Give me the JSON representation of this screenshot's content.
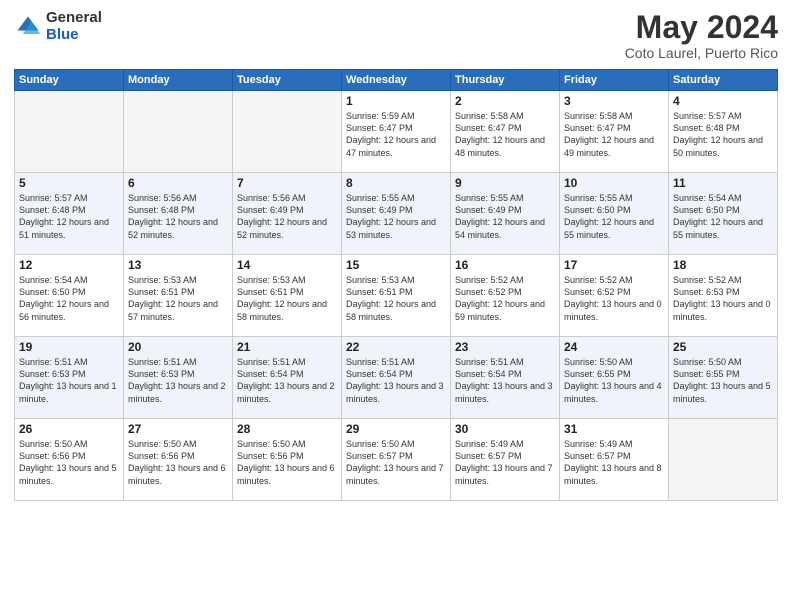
{
  "header": {
    "logo_general": "General",
    "logo_blue": "Blue",
    "title": "May 2024",
    "subtitle": "Coto Laurel, Puerto Rico"
  },
  "days_of_week": [
    "Sunday",
    "Monday",
    "Tuesday",
    "Wednesday",
    "Thursday",
    "Friday",
    "Saturday"
  ],
  "weeks": [
    [
      {
        "day": "",
        "empty": true
      },
      {
        "day": "",
        "empty": true
      },
      {
        "day": "",
        "empty": true
      },
      {
        "day": "1",
        "info": "Sunrise: 5:59 AM\nSunset: 6:47 PM\nDaylight: 12 hours\nand 47 minutes."
      },
      {
        "day": "2",
        "info": "Sunrise: 5:58 AM\nSunset: 6:47 PM\nDaylight: 12 hours\nand 48 minutes."
      },
      {
        "day": "3",
        "info": "Sunrise: 5:58 AM\nSunset: 6:47 PM\nDaylight: 12 hours\nand 49 minutes."
      },
      {
        "day": "4",
        "info": "Sunrise: 5:57 AM\nSunset: 6:48 PM\nDaylight: 12 hours\nand 50 minutes."
      }
    ],
    [
      {
        "day": "5",
        "info": "Sunrise: 5:57 AM\nSunset: 6:48 PM\nDaylight: 12 hours\nand 51 minutes."
      },
      {
        "day": "6",
        "info": "Sunrise: 5:56 AM\nSunset: 6:48 PM\nDaylight: 12 hours\nand 52 minutes."
      },
      {
        "day": "7",
        "info": "Sunrise: 5:56 AM\nSunset: 6:49 PM\nDaylight: 12 hours\nand 52 minutes."
      },
      {
        "day": "8",
        "info": "Sunrise: 5:55 AM\nSunset: 6:49 PM\nDaylight: 12 hours\nand 53 minutes."
      },
      {
        "day": "9",
        "info": "Sunrise: 5:55 AM\nSunset: 6:49 PM\nDaylight: 12 hours\nand 54 minutes."
      },
      {
        "day": "10",
        "info": "Sunrise: 5:55 AM\nSunset: 6:50 PM\nDaylight: 12 hours\nand 55 minutes."
      },
      {
        "day": "11",
        "info": "Sunrise: 5:54 AM\nSunset: 6:50 PM\nDaylight: 12 hours\nand 55 minutes."
      }
    ],
    [
      {
        "day": "12",
        "info": "Sunrise: 5:54 AM\nSunset: 6:50 PM\nDaylight: 12 hours\nand 56 minutes."
      },
      {
        "day": "13",
        "info": "Sunrise: 5:53 AM\nSunset: 6:51 PM\nDaylight: 12 hours\nand 57 minutes."
      },
      {
        "day": "14",
        "info": "Sunrise: 5:53 AM\nSunset: 6:51 PM\nDaylight: 12 hours\nand 58 minutes."
      },
      {
        "day": "15",
        "info": "Sunrise: 5:53 AM\nSunset: 6:51 PM\nDaylight: 12 hours\nand 58 minutes."
      },
      {
        "day": "16",
        "info": "Sunrise: 5:52 AM\nSunset: 6:52 PM\nDaylight: 12 hours\nand 59 minutes."
      },
      {
        "day": "17",
        "info": "Sunrise: 5:52 AM\nSunset: 6:52 PM\nDaylight: 13 hours\nand 0 minutes."
      },
      {
        "day": "18",
        "info": "Sunrise: 5:52 AM\nSunset: 6:53 PM\nDaylight: 13 hours\nand 0 minutes."
      }
    ],
    [
      {
        "day": "19",
        "info": "Sunrise: 5:51 AM\nSunset: 6:53 PM\nDaylight: 13 hours\nand 1 minute."
      },
      {
        "day": "20",
        "info": "Sunrise: 5:51 AM\nSunset: 6:53 PM\nDaylight: 13 hours\nand 2 minutes."
      },
      {
        "day": "21",
        "info": "Sunrise: 5:51 AM\nSunset: 6:54 PM\nDaylight: 13 hours\nand 2 minutes."
      },
      {
        "day": "22",
        "info": "Sunrise: 5:51 AM\nSunset: 6:54 PM\nDaylight: 13 hours\nand 3 minutes."
      },
      {
        "day": "23",
        "info": "Sunrise: 5:51 AM\nSunset: 6:54 PM\nDaylight: 13 hours\nand 3 minutes."
      },
      {
        "day": "24",
        "info": "Sunrise: 5:50 AM\nSunset: 6:55 PM\nDaylight: 13 hours\nand 4 minutes."
      },
      {
        "day": "25",
        "info": "Sunrise: 5:50 AM\nSunset: 6:55 PM\nDaylight: 13 hours\nand 5 minutes."
      }
    ],
    [
      {
        "day": "26",
        "info": "Sunrise: 5:50 AM\nSunset: 6:56 PM\nDaylight: 13 hours\nand 5 minutes."
      },
      {
        "day": "27",
        "info": "Sunrise: 5:50 AM\nSunset: 6:56 PM\nDaylight: 13 hours\nand 6 minutes."
      },
      {
        "day": "28",
        "info": "Sunrise: 5:50 AM\nSunset: 6:56 PM\nDaylight: 13 hours\nand 6 minutes."
      },
      {
        "day": "29",
        "info": "Sunrise: 5:50 AM\nSunset: 6:57 PM\nDaylight: 13 hours\nand 7 minutes."
      },
      {
        "day": "30",
        "info": "Sunrise: 5:49 AM\nSunset: 6:57 PM\nDaylight: 13 hours\nand 7 minutes."
      },
      {
        "day": "31",
        "info": "Sunrise: 5:49 AM\nSunset: 6:57 PM\nDaylight: 13 hours\nand 8 minutes."
      },
      {
        "day": "",
        "empty": true
      }
    ]
  ]
}
